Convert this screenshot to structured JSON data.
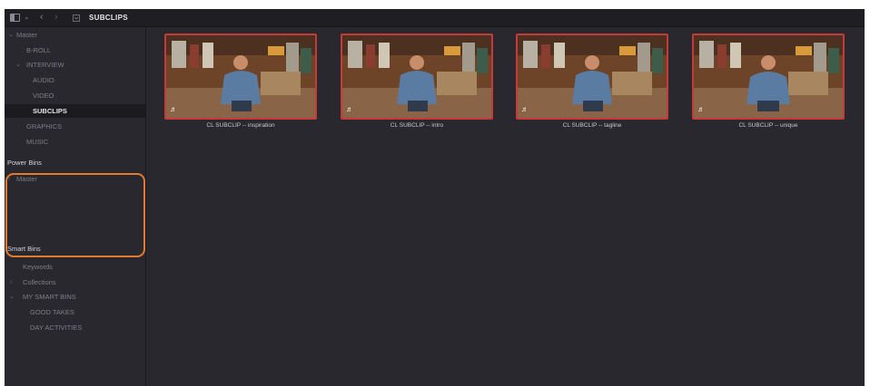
{
  "header": {
    "title": "SUBCLIPS"
  },
  "sidebar": {
    "master_bins": {
      "master_label": "Master",
      "items": [
        "B-ROLL",
        "INTERVIEW",
        "AUDIO",
        "VIDEO",
        "SUBCLIPS",
        "GRAPHICS",
        "MUSIC"
      ]
    },
    "power_bins": {
      "heading": "Power Bins",
      "items": [
        "Master"
      ]
    },
    "smart_bins": {
      "heading": "Smart Bins",
      "items": [
        "Keywords",
        "Collections",
        "MY SMART BINS",
        "GOOD TAKES",
        "DAY ACTIVITIES"
      ]
    }
  },
  "clips": [
    {
      "name": "CL SUBCLIP -- inspiration",
      "audio_icon": "music-note-icon"
    },
    {
      "name": "CL SUBCLIP -- intro",
      "audio_icon": "music-note-icon"
    },
    {
      "name": "CL SUBCLIP -- tagline",
      "audio_icon": "music-note-icon"
    },
    {
      "name": "CL SUBCLIP -- unique",
      "audio_icon": "music-note-icon"
    }
  ],
  "colors": {
    "panel_bg": "#28282e",
    "header_bg": "#1f1f23",
    "selected_bg": "#1b1b1f",
    "clip_border": "#c63a3a",
    "highlight_ring": "#e27a32"
  }
}
